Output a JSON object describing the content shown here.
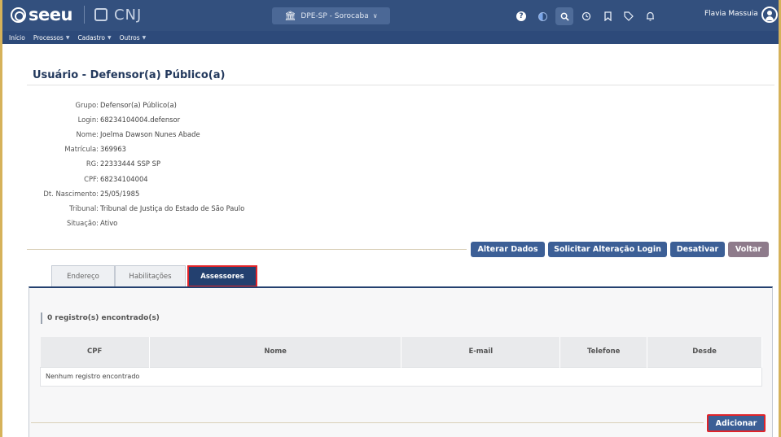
{
  "header": {
    "logo_text": "seeu",
    "cnj_text": "CNJ",
    "unit_select": "DPE-SP - Sorocaba",
    "user_name": "Flavia Massuia",
    "icons": [
      "help-icon",
      "theme-toggle-icon",
      "search-icon",
      "history-icon",
      "bookmark-icon",
      "tag-icon",
      "bell-icon",
      "user-avatar-icon"
    ]
  },
  "menu": {
    "home": "Início",
    "processes": "Processos",
    "register": "Cadastro",
    "others": "Outros"
  },
  "page": {
    "title": "Usuário - Defensor(a) Público(a)"
  },
  "details": [
    {
      "label": "Grupo:",
      "value": "Defensor(a) Público(a)"
    },
    {
      "label": "Login:",
      "value": "68234104004.defensor"
    },
    {
      "label": "Nome:",
      "value": "Joelma Dawson Nunes Abade"
    },
    {
      "label": "Matrícula:",
      "value": "369963"
    },
    {
      "label": "RG:",
      "value": "22333444 SSP SP"
    },
    {
      "label": "CPF:",
      "value": "68234104004"
    },
    {
      "label": "Dt. Nascimento:",
      "value": "25/05/1985"
    },
    {
      "label": "Tribunal:",
      "value": "Tribunal de Justiça do Estado de São Paulo"
    },
    {
      "label": "Situação:",
      "value": "Ativo"
    }
  ],
  "actions": {
    "edit": "Alterar Dados",
    "request_login": "Solicitar Alteração Login",
    "deactivate": "Desativar",
    "back": "Voltar"
  },
  "tabs": {
    "address": "Endereço",
    "qualifications": "Habilitações",
    "assistants": "Assessores"
  },
  "panel": {
    "count": "0 registro(s) encontrado(s)",
    "columns": [
      "CPF",
      "Nome",
      "E-mail",
      "Telefone",
      "Desde"
    ],
    "empty": "Nenhum registro encontrado",
    "add": "Adicionar"
  }
}
